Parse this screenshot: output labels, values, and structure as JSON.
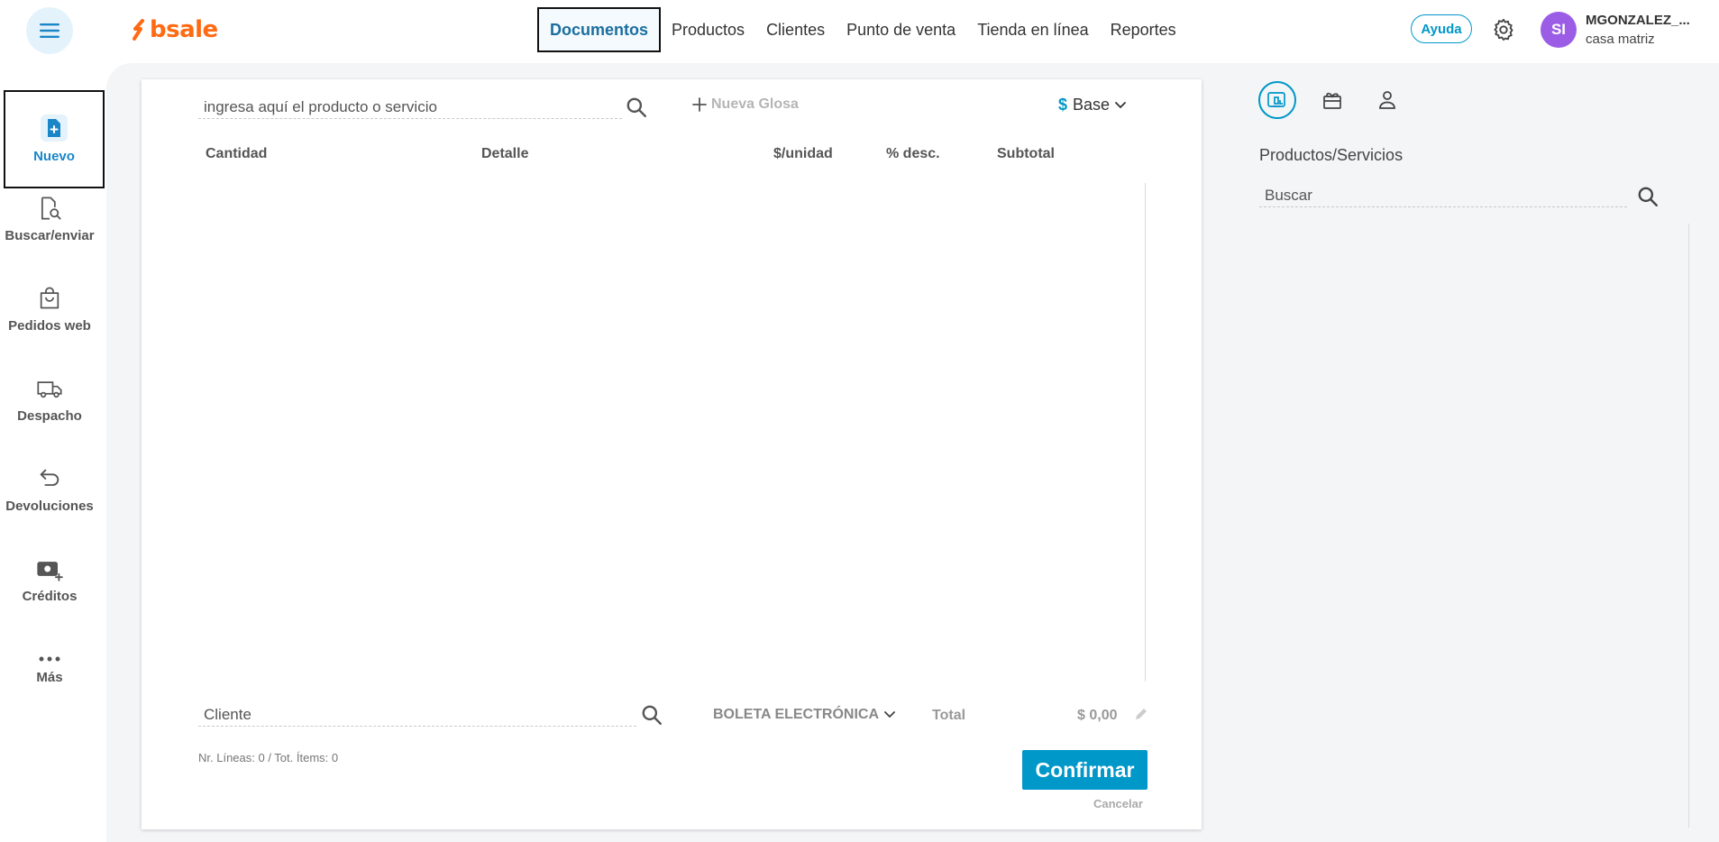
{
  "header": {
    "brand": "bsale",
    "nav": [
      {
        "label": "Documentos",
        "active": true
      },
      {
        "label": "Productos",
        "active": false
      },
      {
        "label": "Clientes",
        "active": false
      },
      {
        "label": "Punto de venta",
        "active": false
      },
      {
        "label": "Tienda en línea",
        "active": false
      },
      {
        "label": "Reportes",
        "active": false
      }
    ],
    "help_label": "Ayuda",
    "user": {
      "initials": "SI",
      "name": "MGONZALEZ_...",
      "branch": "casa matriz"
    }
  },
  "sidebar": {
    "items": [
      {
        "label": "Nuevo",
        "icon": "document-plus-icon",
        "active": true
      },
      {
        "label": "Buscar/enviar",
        "icon": "document-search-icon"
      },
      {
        "label": "Pedidos web",
        "icon": "shopping-bag-icon"
      },
      {
        "label": "Despacho",
        "icon": "truck-icon"
      },
      {
        "label": "Devoluciones",
        "icon": "return-arrow-icon"
      },
      {
        "label": "Créditos",
        "icon": "cash-plus-icon"
      },
      {
        "label": "Más",
        "icon": "more-dots-icon"
      }
    ]
  },
  "document": {
    "product_search_placeholder": "ingresa aquí el producto o servicio",
    "new_gloss_label": "Nueva Glosa",
    "price_list": {
      "symbol": "$",
      "label": "Base"
    },
    "columns": [
      "Cantidad",
      "Detalle",
      "$/unidad",
      "% desc.",
      "Subtotal"
    ],
    "client_placeholder": "Cliente",
    "document_type": "BOLETA ELECTRÓNICA",
    "total_label": "Total",
    "total_value": "$ 0,00",
    "lines_info": "Nr. Líneas: 0 / Tot. Ítems: 0",
    "confirm_label": "Confirmar",
    "cancel_label": "Cancelar"
  },
  "right_panel": {
    "tabs": [
      "products-panel-icon",
      "gift-icon",
      "user-icon"
    ],
    "title": "Productos/Servicios",
    "search_placeholder": "Buscar"
  },
  "colors": {
    "accent": "#0097c9",
    "brand": "#ff6a13",
    "avatar": "#9b5de5"
  }
}
